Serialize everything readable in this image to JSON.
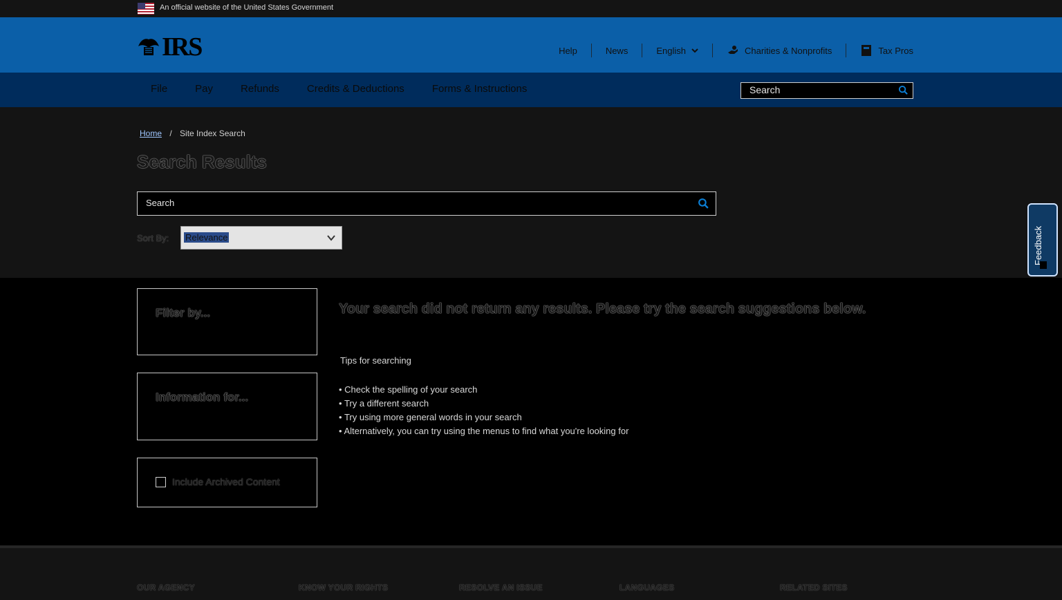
{
  "gov_banner": {
    "text": "An official website of the United States Government"
  },
  "header": {
    "logo_text": "IRS",
    "util_nav": [
      {
        "label": "Help"
      },
      {
        "label": "News"
      },
      {
        "label": "English"
      },
      {
        "label": "Charities & Nonprofits"
      },
      {
        "label": "Tax Pros"
      }
    ]
  },
  "main_nav": {
    "items": [
      {
        "label": "File"
      },
      {
        "label": "Pay"
      },
      {
        "label": "Refunds"
      },
      {
        "label": "Credits & Deductions"
      },
      {
        "label": "Forms & Instructions"
      }
    ],
    "search_placeholder": "Search"
  },
  "breadcrumb": {
    "home": "Home",
    "separator": "/",
    "current": "Site Index Search"
  },
  "page_title": "Search Results",
  "search": {
    "placeholder": "Search"
  },
  "sort": {
    "label": "Sort By:",
    "selected": "Relevance"
  },
  "feedback": {
    "label": "Feedback"
  },
  "filters": {
    "filter_by": "Filter by...",
    "information_for": "Information for...",
    "include_archived": "Include Archived Content"
  },
  "results": {
    "no_results": "Your search did not return any results. Please try the search suggestions below.",
    "tips_title": "Tips for searching",
    "tips": [
      "Check the spelling of your search",
      "Try a different search",
      "Try using more general words in your search",
      "Alternatively, you can try using the menus to find what you're looking for"
    ]
  },
  "footer": {
    "columns": [
      "OUR AGENCY",
      "KNOW YOUR RIGHTS",
      "RESOLVE AN ISSUE",
      "LANGUAGES",
      "RELATED SITES"
    ]
  },
  "colors": {
    "header_blue": "#0b5fa8",
    "nav_navy": "#002c5c",
    "background": "#000000"
  }
}
